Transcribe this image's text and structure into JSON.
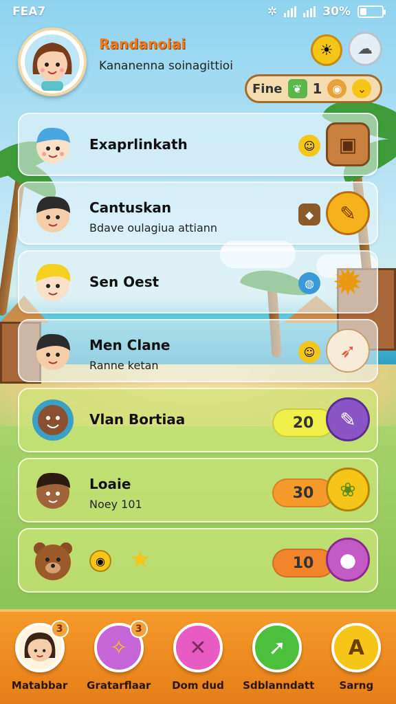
{
  "status_bar": {
    "time": "FEA7",
    "battery_text": "30%",
    "battery_level": 0.3
  },
  "header": {
    "title": "Randanoiai",
    "subtitle": "Kananenna soinagittioi",
    "resource": {
      "label": "Fine",
      "count": "1"
    }
  },
  "list": [
    {
      "name": "Exaprlinkath",
      "sub": "",
      "accent": "#d6a45a"
    },
    {
      "name": "Cantuskan",
      "sub": "Bdave oulagiua attiann",
      "accent": "#f5b21c"
    },
    {
      "name": "Sen Oest",
      "sub": "",
      "accent": "#f5b21c"
    },
    {
      "name": "Men Clane",
      "sub": "Ranne ketan",
      "accent": "#e05a3a"
    },
    {
      "name": "Vlan Bortiaa",
      "sub": "",
      "score": "20",
      "score_color": "#f0ef4a",
      "accent": "#8a55c6"
    },
    {
      "name": "Loaie",
      "sub": "Noey 101",
      "score": "30",
      "score_color": "#f79a2c",
      "accent": "#f5c518"
    },
    {
      "name": "",
      "sub": "",
      "score": "10",
      "score_color": "#f2842a",
      "accent": "#c45ac6"
    }
  ],
  "nav": [
    {
      "label": "Matabbar",
      "badge": "3",
      "color": "#fff4e0"
    },
    {
      "label": "Gratarflaar",
      "badge": "3",
      "color": "#c565d8"
    },
    {
      "label": "Dom dud",
      "badge": "",
      "color": "#e75bc2"
    },
    {
      "label": "Sdblanndatt",
      "badge": "",
      "color": "#4cbf3c"
    },
    {
      "label": "Sarng",
      "badge": "",
      "color": "#f5c518"
    }
  ]
}
